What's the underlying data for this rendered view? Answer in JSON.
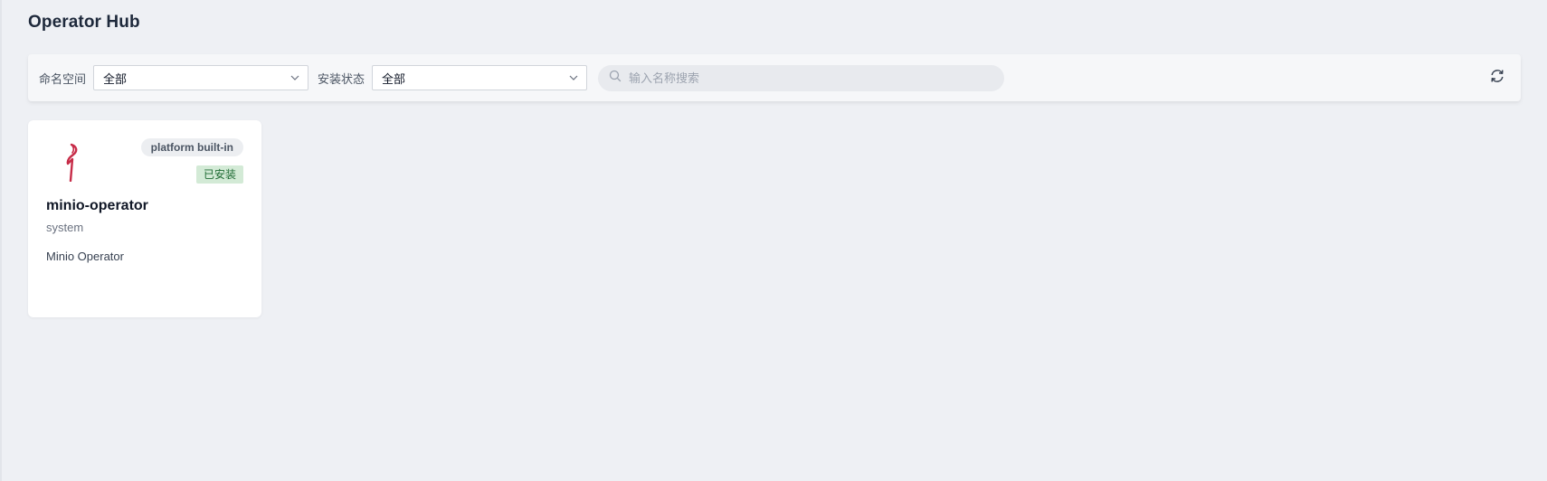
{
  "page": {
    "title": "Operator Hub"
  },
  "filters": {
    "namespace_label": "命名空间",
    "namespace_value": "全部",
    "status_label": "安装状态",
    "status_value": "全部",
    "search_placeholder": "输入名称搜索",
    "search_value": ""
  },
  "icons": {
    "search": "search-icon",
    "chevron": "chevron-down-icon",
    "refresh": "refresh-icon",
    "logo": "minio-logo-icon"
  },
  "colors": {
    "accent_logo": "#c72c48",
    "installed_badge_bg": "#d3ead6",
    "installed_badge_text": "#1f6b34"
  },
  "operators": [
    {
      "name": "minio-operator",
      "namespace": "system",
      "description": "Minio Operator",
      "tag": "platform built-in",
      "status": "已安装"
    }
  ]
}
